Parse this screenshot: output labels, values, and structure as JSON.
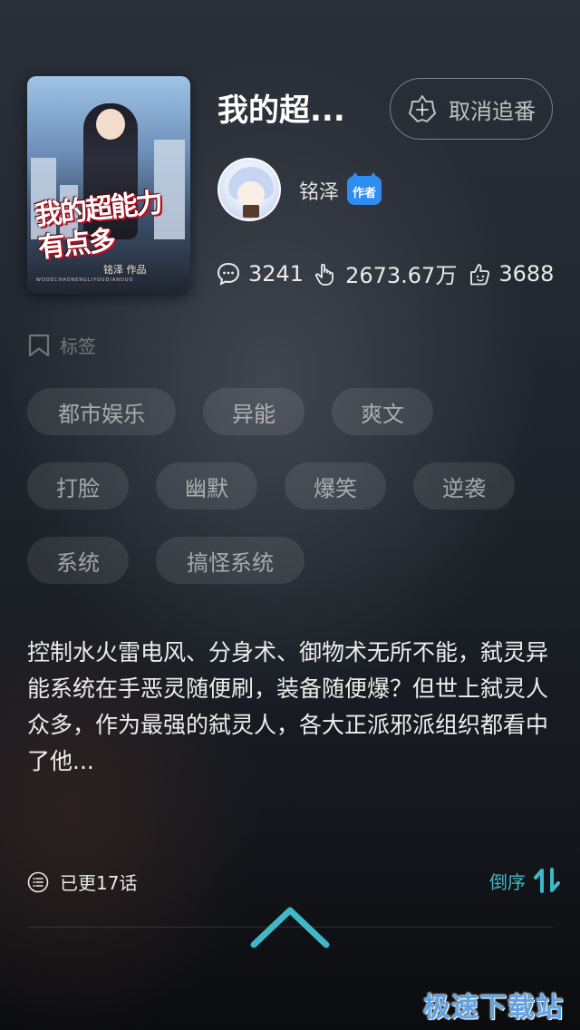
{
  "book": {
    "cover_title": "我的超能力有点多",
    "cover_author": "铭泽 作品",
    "cover_subtitle": "WODECHAONENGLIYOUDIANDUO",
    "title": "我的超...",
    "unfollow_label": "取消追番"
  },
  "author": {
    "name": "铭泽",
    "badge_label": "作者"
  },
  "stats": {
    "comments": "3241",
    "likes": "2673.67万",
    "fans": "3688"
  },
  "tags_section": {
    "label": "标签",
    "tags": [
      "都市娱乐",
      "异能",
      "爽文",
      "打脸",
      "幽默",
      "爆笑",
      "逆袭",
      "系统",
      "搞怪系统"
    ]
  },
  "description": "控制水火雷电风、分身术、御物术无所不能，弑灵异能系统在手恶灵随便刷，装备随便爆？但世上弑灵人众多，作为最强的弑灵人，各大正派邪派组织都看中了他...",
  "episodes": {
    "updated_label": "已更17话",
    "sort_label": "倒序"
  },
  "watermark": "极速下载站",
  "colors": {
    "accent": "#3fb8c9",
    "badge": "#2f8cf0",
    "watermark": "#5ea3e6"
  }
}
